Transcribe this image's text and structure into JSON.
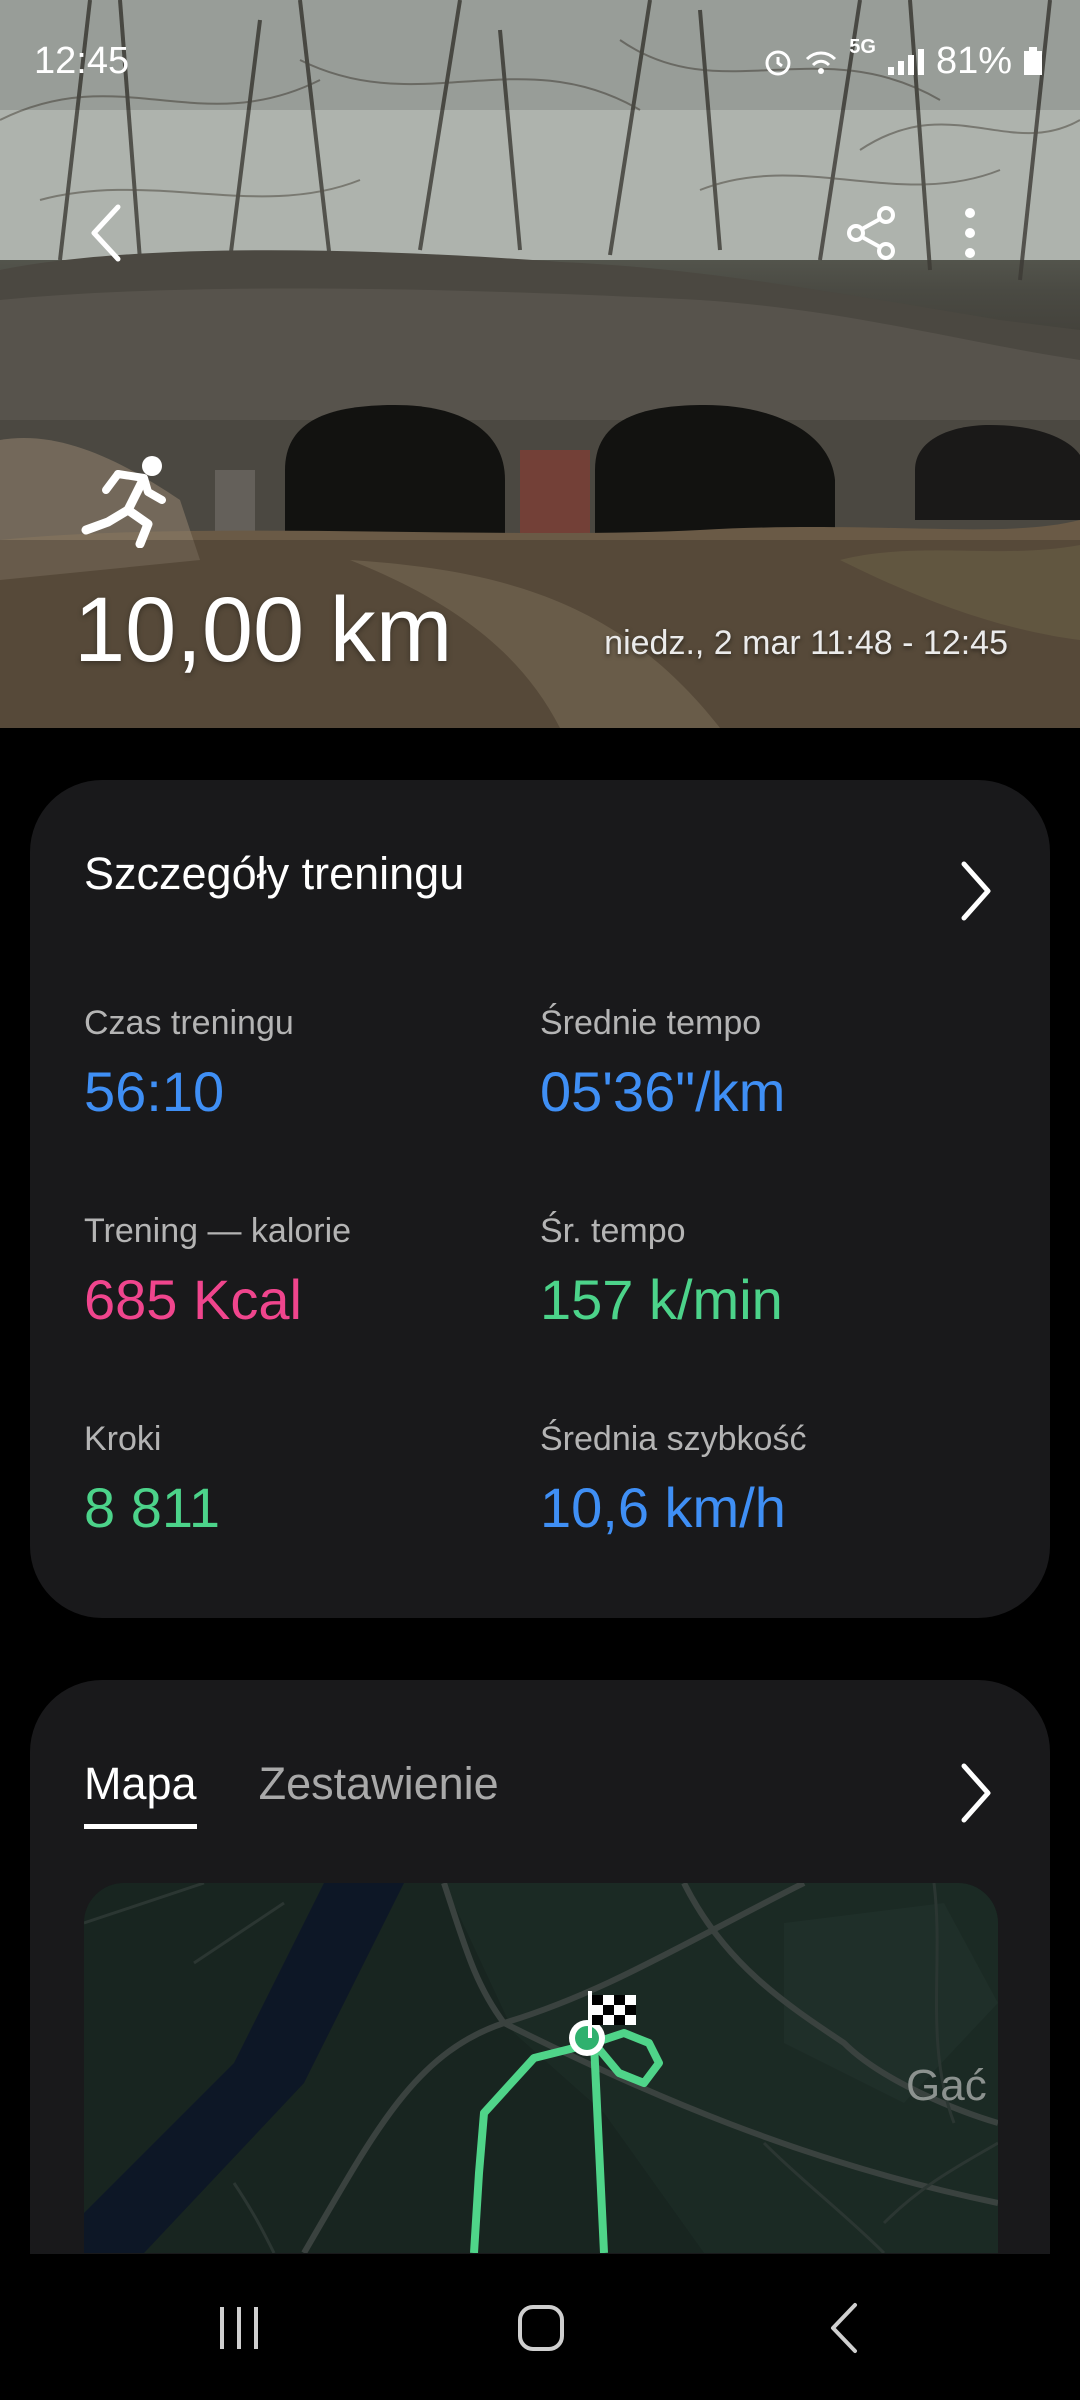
{
  "status_bar": {
    "time": "12:45",
    "network": "5G",
    "battery": "81%"
  },
  "hero": {
    "distance": "10,00 km",
    "datetime": "niedz., 2 mar 11:48 - 12:45",
    "activity_icon": "running-person-icon"
  },
  "details": {
    "title": "Szczegóły treningu",
    "stats": [
      {
        "label": "Czas treningu",
        "value": "56:10",
        "color": "#3f8ff5"
      },
      {
        "label": "Średnie tempo",
        "value": "05'36\"/km",
        "color": "#3f8ff5"
      },
      {
        "label": "Trening — kalorie",
        "value": "685 Kcal",
        "color": "#f0458d"
      },
      {
        "label": "Śr. tempo",
        "value": "157 k/min",
        "color": "#4cd38a"
      },
      {
        "label": "Kroki",
        "value": "8 811",
        "color": "#4cd38a"
      },
      {
        "label": "Średnia szybkość",
        "value": "10,6 km/h",
        "color": "#3f8ff5"
      }
    ]
  },
  "map_card": {
    "tabs": [
      {
        "label": "Mapa",
        "active": true
      },
      {
        "label": "Zestawienie",
        "active": false
      }
    ],
    "place_label": "Gać"
  }
}
